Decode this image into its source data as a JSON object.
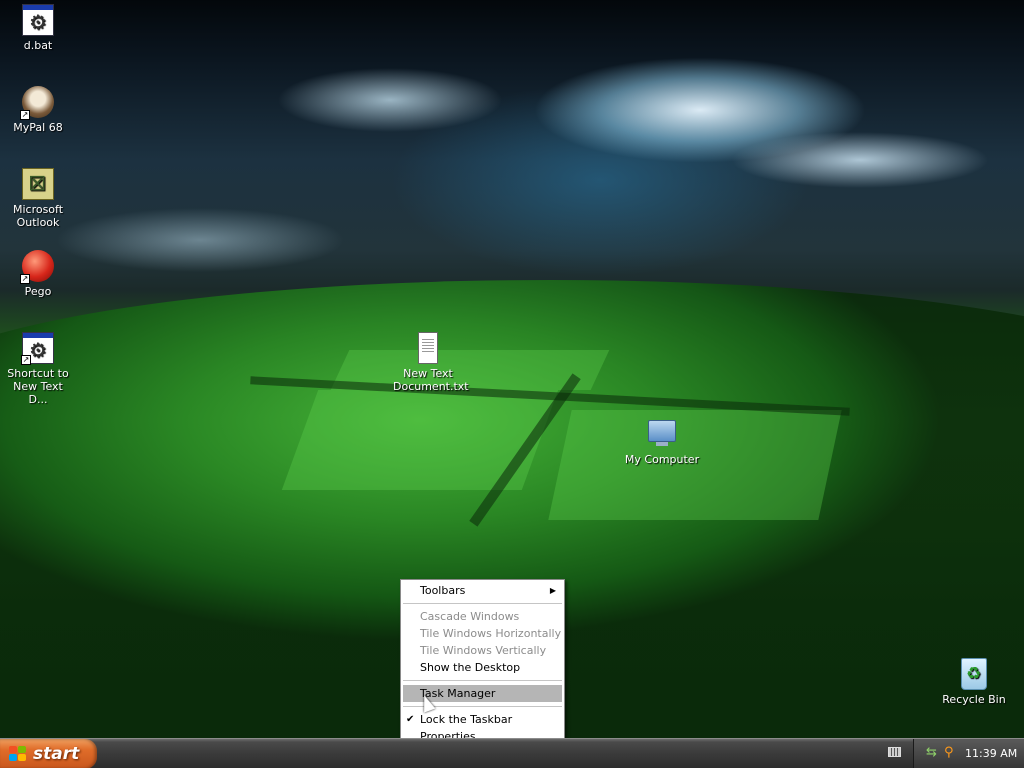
{
  "desktop": {
    "icons": [
      {
        "label": "d.bat"
      },
      {
        "label": "MyPal 68"
      },
      {
        "label": "Microsoft Outlook"
      },
      {
        "label": "Pego"
      },
      {
        "label": "Shortcut to New Text D..."
      },
      {
        "label": "New Text Document.txt"
      },
      {
        "label": "My Computer"
      },
      {
        "label": "Recycle Bin"
      }
    ]
  },
  "context_menu": {
    "items": [
      {
        "label": "Toolbars"
      },
      {
        "label": "Cascade Windows"
      },
      {
        "label": "Tile Windows Horizontally"
      },
      {
        "label": "Tile Windows Vertically"
      },
      {
        "label": "Show the Desktop"
      },
      {
        "label": "Task Manager"
      },
      {
        "label": "Lock the Taskbar"
      },
      {
        "label": "Properties"
      }
    ]
  },
  "taskbar": {
    "start_label": "start",
    "clock": "11:39 AM"
  }
}
